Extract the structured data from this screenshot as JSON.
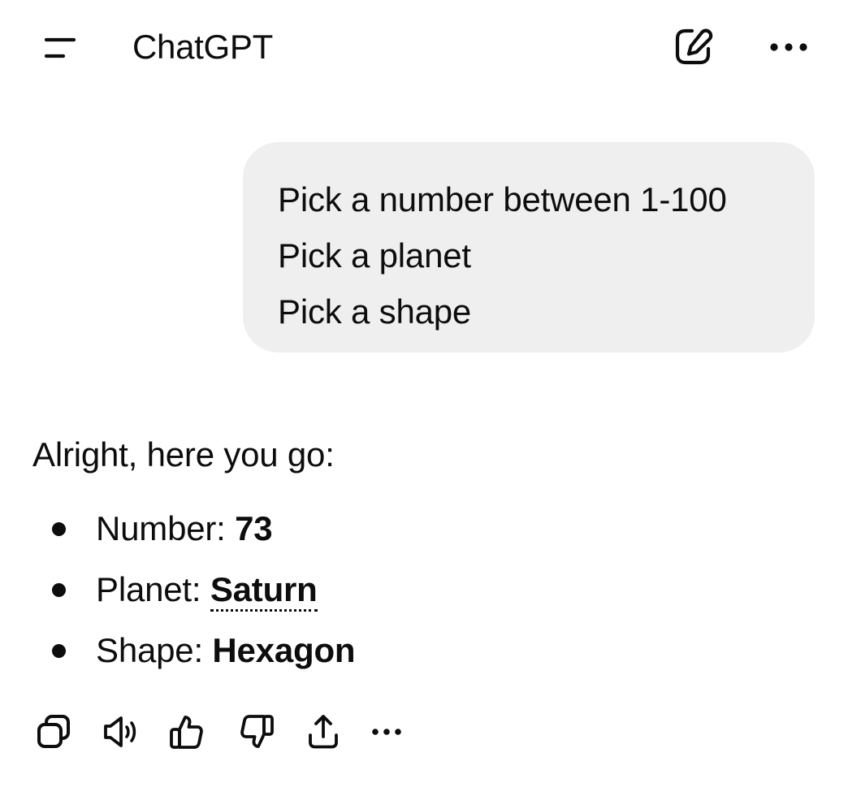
{
  "header": {
    "title": "ChatGPT",
    "icons": {
      "menu": "menu-icon",
      "compose": "compose-icon",
      "more": "more-icon"
    }
  },
  "conversation": {
    "user_message": {
      "lines": [
        "Pick a number between 1-100",
        "Pick a planet",
        "Pick a shape"
      ]
    },
    "assistant_message": {
      "intro": "Alright, here you go:",
      "items": [
        {
          "label": "Number: ",
          "value": "73"
        },
        {
          "label": "Planet: ",
          "value": "Saturn"
        },
        {
          "label": "Shape: ",
          "value": "Hexagon"
        }
      ]
    }
  },
  "actions": [
    {
      "icon": "copy-icon"
    },
    {
      "icon": "speaker-icon"
    },
    {
      "icon": "thumbs-up-icon"
    },
    {
      "icon": "thumbs-down-icon"
    },
    {
      "icon": "share-icon"
    },
    {
      "icon": "more-icon"
    }
  ],
  "colors": {
    "text": "#0d0d0d",
    "bubble": "#efefef",
    "background": "#ffffff"
  }
}
